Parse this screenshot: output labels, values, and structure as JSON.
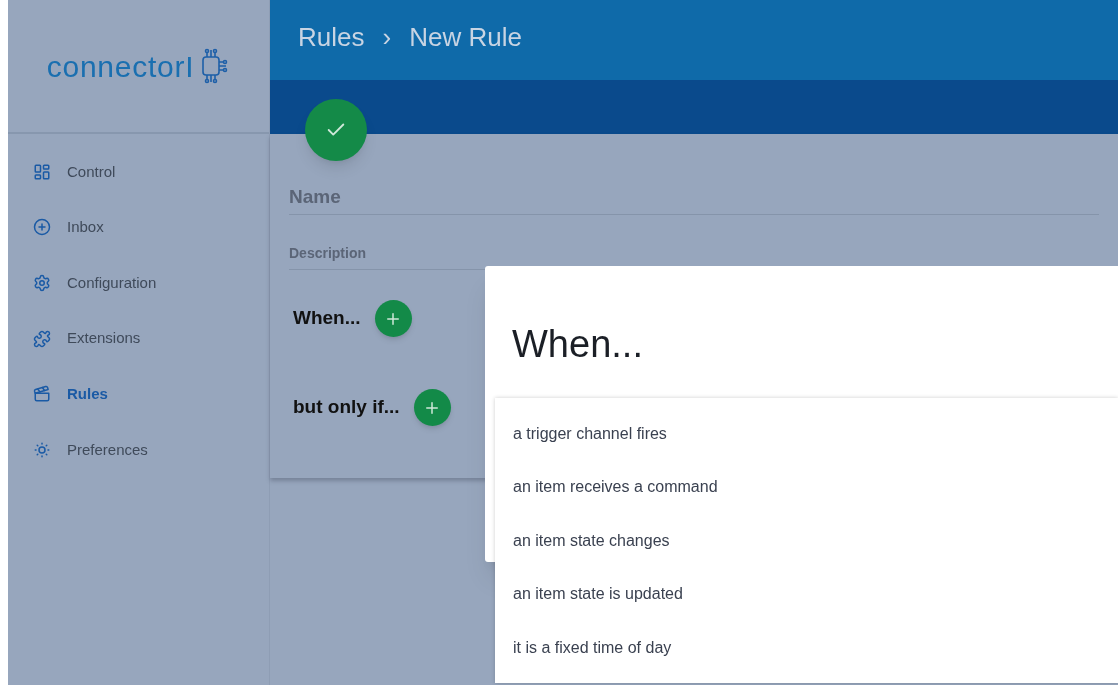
{
  "logo": {
    "text": "connectorI"
  },
  "sidebar": {
    "items": [
      {
        "label": "Control",
        "kind": "dashboard",
        "selected": false
      },
      {
        "label": "Inbox",
        "kind": "inbox",
        "selected": false
      },
      {
        "label": "Configuration",
        "kind": "settings",
        "selected": false
      },
      {
        "label": "Extensions",
        "kind": "extensions",
        "selected": false
      },
      {
        "label": "Rules",
        "kind": "rules",
        "selected": true
      },
      {
        "label": "Preferences",
        "kind": "preferences",
        "selected": false
      }
    ]
  },
  "header": {
    "breadcrumb": [
      "Rules",
      "New Rule"
    ],
    "separator": "›"
  },
  "form": {
    "name_placeholder": "Name",
    "description_placeholder": "Description",
    "sections": [
      "When...",
      "but only if..."
    ]
  },
  "dialog": {
    "title": "When...",
    "options": [
      "a trigger channel fires",
      "an item receives a command",
      "an item state changes",
      "an item state is updated",
      "it is a fixed time of day"
    ]
  }
}
